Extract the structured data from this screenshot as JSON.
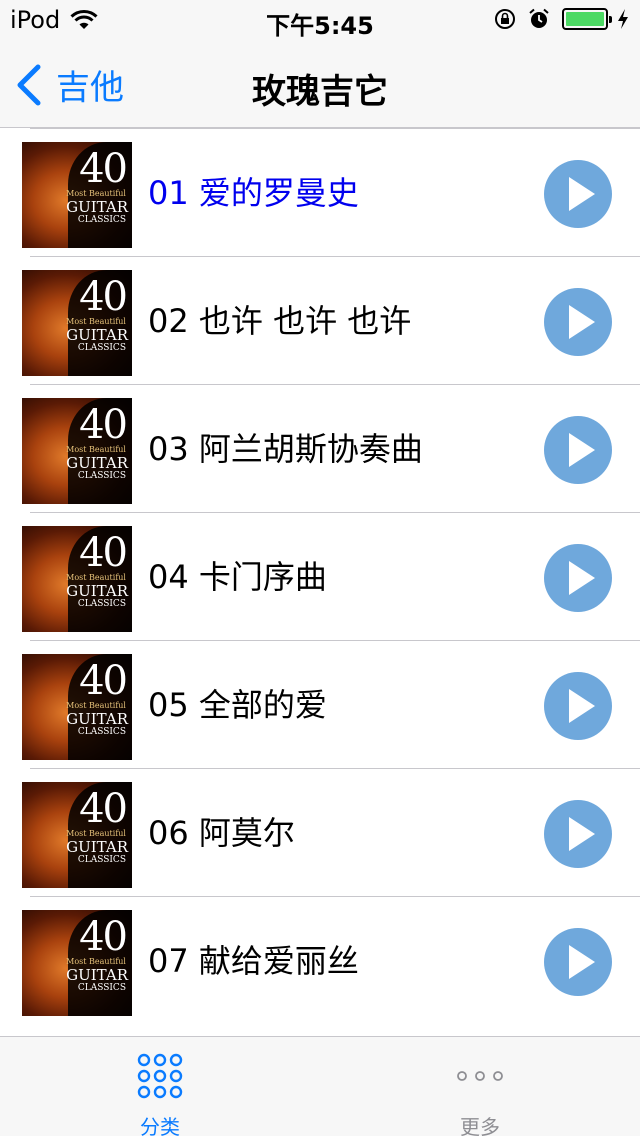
{
  "status_bar": {
    "carrier": "iPod",
    "time": "下午5:45",
    "battery_level": 1.0,
    "battery_color": "#4cd964"
  },
  "nav": {
    "back_label": "吉他",
    "title": "玫瑰吉它",
    "accent_color": "#0a7bff"
  },
  "album_art": {
    "number": "40",
    "line1": "Most Beautiful",
    "line2": "GUITAR",
    "line3": "CLASSICS"
  },
  "tracks": [
    {
      "title": "01 爱的罗曼史",
      "active": true
    },
    {
      "title": "02 也许 也许 也许",
      "active": false
    },
    {
      "title": "03 阿兰胡斯协奏曲",
      "active": false
    },
    {
      "title": "04 卡门序曲",
      "active": false
    },
    {
      "title": "05 全部的爱",
      "active": false
    },
    {
      "title": "06 阿莫尔",
      "active": false
    },
    {
      "title": "07 献给爱丽丝",
      "active": false
    }
  ],
  "play_button_color": "#6fa8dc",
  "tab_bar": {
    "tabs": [
      {
        "label": "分类",
        "icon": "grid-icon",
        "selected": true
      },
      {
        "label": "更多",
        "icon": "more-dots-icon",
        "selected": false
      }
    ]
  }
}
